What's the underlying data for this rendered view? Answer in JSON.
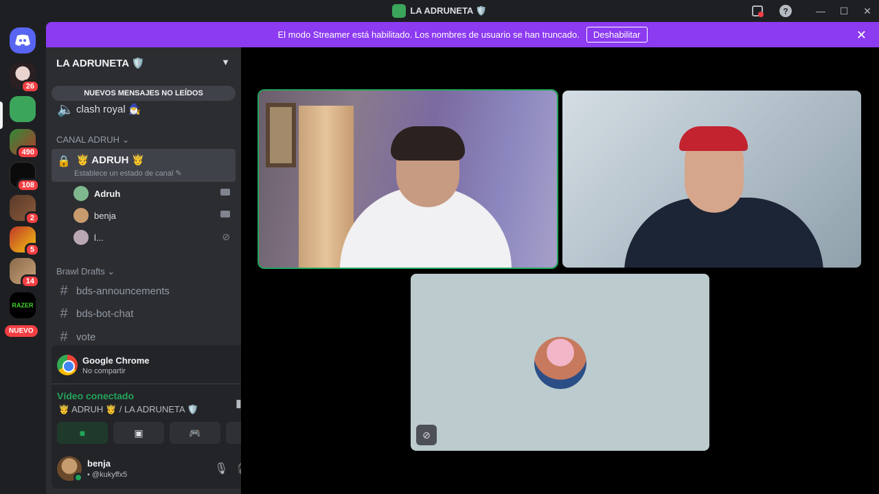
{
  "window": {
    "title": "LA ADRUNETA 🛡️",
    "controls": [
      "—",
      "☐",
      "✕"
    ]
  },
  "banner": {
    "text": "El modo Streamer está habilitado. Los nombres de usuario se han truncado.",
    "button": "Deshabilitar",
    "close": "✕"
  },
  "rail": {
    "badges": [
      "26",
      "490",
      "108",
      "2",
      "5",
      "14"
    ],
    "new_label": "NUEVO"
  },
  "guild": {
    "name": "LA ADRUNETA 🛡️",
    "unread_pill": "NUEVOS MENSAJES NO LEÍDOS"
  },
  "channels": {
    "voice1": "clash royal 🧙‍♂️",
    "category1": "CANAL ADRUH ⌄",
    "active_voice": "🤴 ADRUH 🤴",
    "active_status": "Establece un estado de canal ✎",
    "members": [
      {
        "name": "Adruh",
        "color": "#7fb88f"
      },
      {
        "name": "benja",
        "color": "#c89b6e"
      },
      {
        "name": "l...",
        "color": "#b9a7b1"
      }
    ],
    "category2": "Brawl Drafts ⌄",
    "text_channels": [
      "bds-announcements",
      "bds-bot-chat",
      "vote"
    ]
  },
  "activity": {
    "app": "Google Chrome",
    "state": "No compartir"
  },
  "voice": {
    "state": "Vídeo conectado",
    "location": "🤴 ADRUH 🤴 / LA ADRUNETA 🛡️"
  },
  "user": {
    "name": "benja",
    "tag": "• @kukyffx5"
  },
  "colors": {
    "banner": "#8c3bf1",
    "connected": "#23a55a",
    "badge": "#f23f43"
  }
}
